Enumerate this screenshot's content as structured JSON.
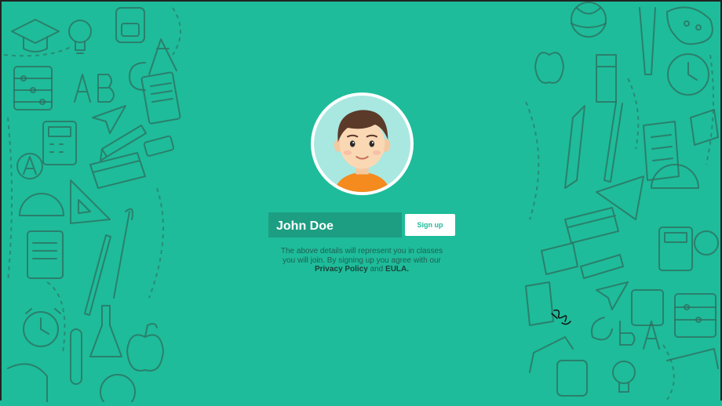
{
  "profile": {
    "avatar_icon": "boy-avatar-icon",
    "name_value": "John Doe"
  },
  "actions": {
    "signup_label": "Sign up"
  },
  "terms": {
    "line1": "The above details will represent you in classes",
    "line2": "you will join. By signing up you agree with our",
    "privacy_link": "Privacy Policy",
    "and_text": "and",
    "eula_link": "EULA."
  },
  "colors": {
    "background": "#1ebc9a",
    "field": "#1d9e82",
    "button": "#ffffff",
    "doodle_stroke": "#2f6c5e"
  }
}
